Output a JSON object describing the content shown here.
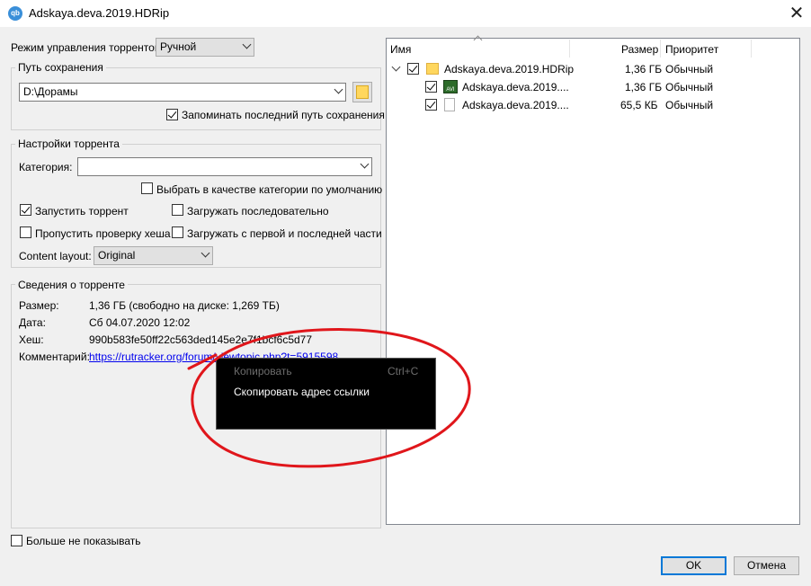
{
  "window": {
    "title": "Adskaya.deva.2019.HDRip",
    "app_icon": "qbittorrent-icon"
  },
  "torrent_mode": {
    "label": "Режим управления торрентом:",
    "value": "Ручной"
  },
  "save_path": {
    "group_title": "Путь сохранения",
    "value": "D:\\Дорамы",
    "remember_label": "Запоминать последний путь сохранения",
    "remember_checked": true
  },
  "torrent_settings": {
    "group_title": "Настройки торрента",
    "category_label": "Категория:",
    "category_value": "",
    "default_category_label": "Выбрать в качестве категории по умолчанию",
    "start_label": "Запустить торрент",
    "start_checked": true,
    "sequential_label": "Загружать последовательно",
    "skip_hash_label": "Пропустить проверку хеша",
    "first_last_label": "Загружать с первой и последней части",
    "layout_label": "Content layout:",
    "layout_value": "Original"
  },
  "torrent_info": {
    "group_title": "Сведения о торренте",
    "size_label": "Размер:",
    "size_value": "1,36 ГБ (свободно на диске: 1,269 ТБ)",
    "date_label": "Дата:",
    "date_value": "Сб 04.07.2020 12:02",
    "hash_label": "Хеш:",
    "hash_value": "990b583fe50ff22c563ded145e2e7f1bcf6c5d77",
    "comment_label": "Комментарий:",
    "comment_value": "https://rutracker.org/forum/viewtopic.php?t=5915598"
  },
  "file_tree": {
    "columns": [
      "Имя",
      "Размер",
      "Приоритет"
    ],
    "rows": [
      {
        "name": "Adskaya.deva.2019.HDRip",
        "size": "1,36 ГБ",
        "priority": "Обычный",
        "icon": "folder-icon"
      },
      {
        "name": "Adskaya.deva.2019....",
        "size": "1,36 ГБ",
        "priority": "Обычный",
        "icon": "avi-video-icon",
        "icon_text": "AVI"
      },
      {
        "name": "Adskaya.deva.2019....",
        "size": "65,5 КБ",
        "priority": "Обычный",
        "icon": "file-icon"
      }
    ]
  },
  "context_menu": {
    "items": [
      {
        "label": "Копировать",
        "shortcut": "Ctrl+C",
        "disabled": true
      },
      {
        "label": "Скопировать адрес ссылки",
        "shortcut": "",
        "disabled": false
      }
    ]
  },
  "footer": {
    "dont_show_label": "Больше не показывать",
    "ok_label": "OK",
    "cancel_label": "Отмена"
  },
  "annotation": {
    "color": "#e0161b"
  }
}
